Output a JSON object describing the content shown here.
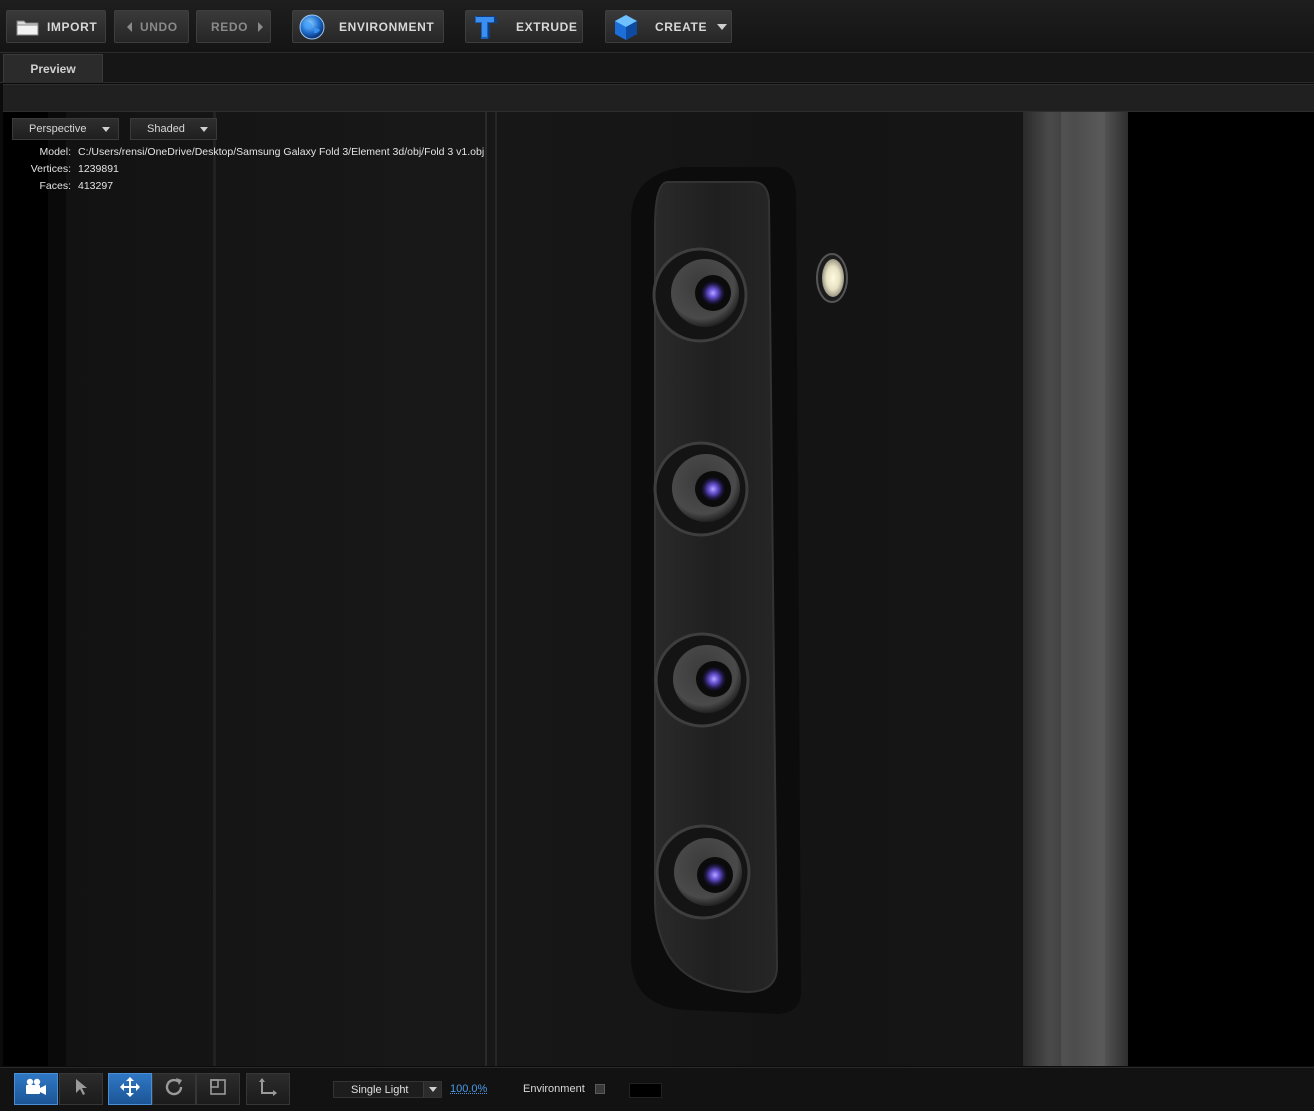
{
  "toolbar": {
    "import_label": "IMPORT",
    "undo_label": "UNDO",
    "redo_label": "REDO",
    "environment_label": "ENVIRONMENT",
    "extrude_label": "EXTRUDE",
    "create_label": "CREATE"
  },
  "tabs": {
    "preview": "Preview"
  },
  "viewport": {
    "view_mode": "Perspective",
    "shading_mode": "Shaded",
    "info": {
      "model_label": "Model:",
      "model_path": "C:/Users/rensi/OneDrive/Desktop/Samsung Galaxy Fold 3/Element 3d/obj/Fold 3 v1.obj",
      "vertices_label": "Vertices:",
      "vertices": "1239891",
      "faces_label": "Faces:",
      "faces": "413297"
    }
  },
  "bottom": {
    "lighting_preset": "Single Light",
    "zoom": "100.0%",
    "environment_label": "Environment",
    "environment_checked": false,
    "active_tool": "camera",
    "accent_color": "#2f78c4"
  }
}
